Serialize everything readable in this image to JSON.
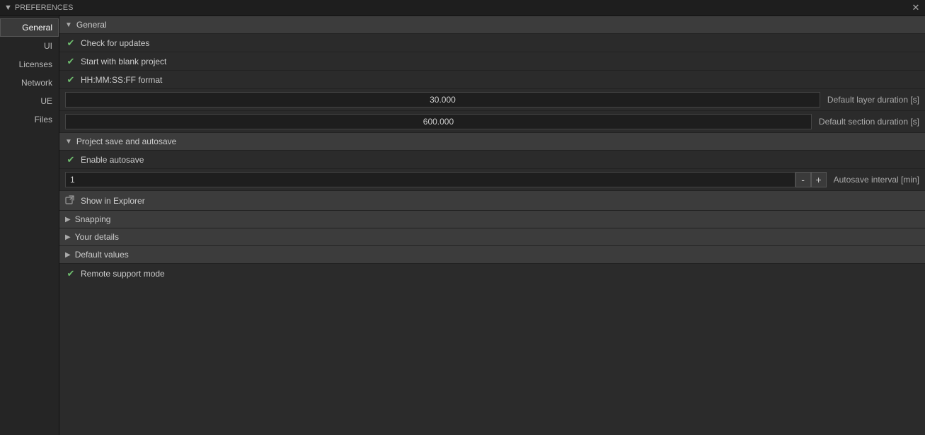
{
  "titleBar": {
    "triangle": "▼",
    "title": "PREFERENCES",
    "closeButton": "✕"
  },
  "sidebar": {
    "items": [
      {
        "id": "general",
        "label": "General",
        "active": true
      },
      {
        "id": "ui",
        "label": "UI",
        "active": false
      },
      {
        "id": "licenses",
        "label": "Licenses",
        "active": false
      },
      {
        "id": "network",
        "label": "Network",
        "active": false
      },
      {
        "id": "ue",
        "label": "UE",
        "active": false
      },
      {
        "id": "files",
        "label": "Files",
        "active": false
      }
    ]
  },
  "content": {
    "generalSection": {
      "label": "General",
      "collapseIcon": "▼"
    },
    "checkboxItems": [
      {
        "id": "check-updates",
        "label": "Check for updates",
        "checked": true
      },
      {
        "id": "blank-project",
        "label": "Start with blank project",
        "checked": true
      },
      {
        "id": "hhmm-format",
        "label": "HH:MM:SS:FF format",
        "checked": true
      }
    ],
    "inputRows": [
      {
        "id": "layer-duration",
        "value": "30.000",
        "label": "Default layer duration [s]"
      },
      {
        "id": "section-duration",
        "value": "600.000",
        "label": "Default section duration [s]"
      }
    ],
    "autosaveSection": {
      "label": "Project save and autosave",
      "collapseIcon": "▼"
    },
    "enableAutosave": {
      "label": "Enable autosave",
      "checked": true
    },
    "autosaveInterval": {
      "value": "1",
      "minus": "-",
      "plus": "+",
      "label": "Autosave interval [min]"
    },
    "showInExplorer": {
      "icon": "↗",
      "label": "Show in Explorer"
    },
    "collapsedSections": [
      {
        "id": "snapping",
        "label": "Snapping",
        "icon": "▶"
      },
      {
        "id": "your-details",
        "label": "Your details",
        "icon": "▶"
      },
      {
        "id": "default-values",
        "label": "Default values",
        "icon": "▶"
      }
    ],
    "remoteSupport": {
      "label": "Remote support mode",
      "checked": true
    }
  }
}
